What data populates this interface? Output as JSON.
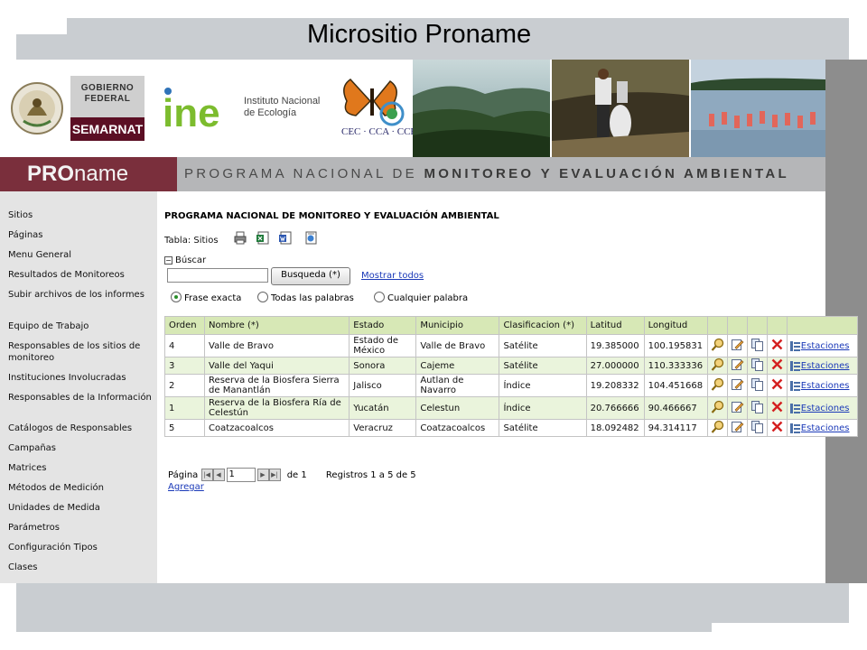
{
  "slide": {
    "title": "Micrositio Proname"
  },
  "logos": {
    "gobierno": "GOBIERNO\nFEDERAL",
    "semarnat": "SEMARNAT",
    "ine_mark": "ine",
    "ine": "Instituto Nacional\nde Ecología",
    "cec": "CEC · CCA · CCE"
  },
  "banner": {
    "brand_bold": "PRO",
    "brand_rest": "name",
    "program_light": "PROGRAMA NACIONAL DE ",
    "program_bold": "MONITOREO Y EVALUACIÓN AMBIENTAL"
  },
  "sidebar": {
    "items": [
      {
        "label": "Sitios"
      },
      {
        "label": "Páginas"
      },
      {
        "label": "Menu General"
      },
      {
        "label": "Resultados de Monitoreos"
      },
      {
        "label": "Subir archivos de los informes"
      },
      {
        "label": "Equipo de Trabajo"
      },
      {
        "label": "Responsables de los sitios de monitoreo"
      },
      {
        "label": "Instituciones Involucradas"
      },
      {
        "label": "Responsables de la Información"
      },
      {
        "label": "Catálogos de Responsables"
      },
      {
        "label": "Campañas"
      },
      {
        "label": "Matrices"
      },
      {
        "label": "Métodos de Medición"
      },
      {
        "label": "Unidades de Medida"
      },
      {
        "label": "Parámetros"
      },
      {
        "label": "Configuración Tipos"
      },
      {
        "label": "Clases"
      }
    ]
  },
  "main": {
    "title": "PROGRAMA NACIONAL DE MONITOREO Y EVALUACIÓN AMBIENTAL",
    "tabla_label": "Tabla: Sitios",
    "buscar_label": "Búscar",
    "search": {
      "value": "",
      "button": "Busqueda (*)",
      "show_all": "Mostrar todos"
    },
    "radios": [
      {
        "label": "Frase exacta",
        "checked": true
      },
      {
        "label": "Todas las palabras",
        "checked": false
      },
      {
        "label": "Cualquier palabra",
        "checked": false
      }
    ]
  },
  "table": {
    "columns": [
      "Orden",
      "Nombre (*)",
      "Estado",
      "Municipio",
      "Clasificacion (*)",
      "Latitud",
      "Longitud"
    ],
    "rows": [
      {
        "orden": "4",
        "nombre": "Valle de Bravo",
        "estado": "Estado de México",
        "municipio": "Valle de Bravo",
        "clasificacion": "Satélite",
        "latitud": "19.385000",
        "longitud": "100.195831"
      },
      {
        "orden": "3",
        "nombre": "Valle del Yaqui",
        "estado": "Sonora",
        "municipio": "Cajeme",
        "clasificacion": "Satélite",
        "latitud": "27.000000",
        "longitud": "110.333336"
      },
      {
        "orden": "2",
        "nombre": "Reserva de la Biosfera Sierra de Manantlán",
        "estado": "Jalisco",
        "municipio": "Autlan de Navarro",
        "clasificacion": "Índice",
        "latitud": "19.208332",
        "longitud": "104.451668"
      },
      {
        "orden": "1",
        "nombre": "Reserva de la Biosfera Ría de Celestún",
        "estado": "Yucatán",
        "municipio": "Celestun",
        "clasificacion": "Índice",
        "latitud": "20.766666",
        "longitud": "90.466667"
      },
      {
        "orden": "5",
        "nombre": "Coatzacoalcos",
        "estado": "Veracruz",
        "municipio": "Coatzacoalcos",
        "clasificacion": "Satélite",
        "latitud": "18.092482",
        "longitud": "94.314117"
      }
    ],
    "estaciones_label": "Estaciones"
  },
  "pager": {
    "page_label": "Página",
    "page_value": "1",
    "of_label": "de 1",
    "records": "Registros 1 a 5 de 5"
  },
  "agregar": "Agregar",
  "colors": {
    "accent_green": "#d7e8b6",
    "row_alt": "#eaf4dc",
    "brand_maroon": "#7a2f3c",
    "link": "#1a39b8"
  }
}
